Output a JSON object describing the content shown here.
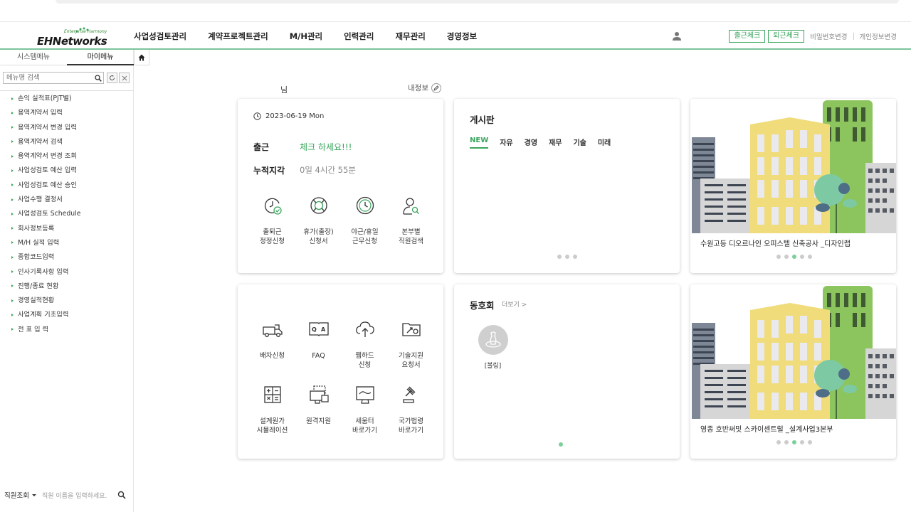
{
  "logo": {
    "sub": "Enterprise Harmony",
    "main": "EHNetworks"
  },
  "gnb": {
    "menu": [
      "사업성검토관리",
      "계약프로젝트관리",
      "M/H관리",
      "인력관리",
      "재무관리",
      "경영정보"
    ],
    "check_in": "출근체크",
    "check_out": "퇴근체크",
    "pw_change": "비밀번호변경",
    "info_change": "개인정보변경"
  },
  "sidebar": {
    "tab_system": "시스템메뉴",
    "tab_my": "마이메뉴",
    "search_placeholder": "메뉴명 검색",
    "items": [
      "손익 실적표(PJT별)",
      "용역계약서 입력",
      "용역계약서 변경 입력",
      "용역계약서 검색",
      "용역계약서 변경 조회",
      "사업성검토 예산 입력",
      "사업성검토 예산 승인",
      "사업수행 결정서",
      "사업성검토 Schedule",
      "회사정보등록",
      "M/H 실적 입력",
      "종합코드입력",
      "인사기록사항 입력",
      "진행/종료 현황",
      "경영실적현황",
      "사업계획 기초입력",
      "전 표 입 력"
    ],
    "emp_select": "직원조회",
    "emp_placeholder": "직원 이름을 입력하세요."
  },
  "greeting": {
    "name_suffix": "님",
    "my_info": "내정보"
  },
  "attendance": {
    "date": "2023-06-19 Mon",
    "in_label": "출근",
    "in_msg": "체크  하세요!!!",
    "late_label": "누적지각",
    "late_value": "0일 4시간 55분",
    "quick": [
      {
        "label": "출퇴근\n정정신청",
        "icon": "clock-check-icon"
      },
      {
        "label": "휴가(출장)\n신청서",
        "icon": "lifebuoy-icon"
      },
      {
        "label": "야근/휴일\n근무신청",
        "icon": "clock-icon"
      },
      {
        "label": "본부별\n직원검색",
        "icon": "person-search-icon"
      }
    ]
  },
  "board": {
    "title": "게시판",
    "tabs": [
      "NEW",
      "자유",
      "경영",
      "재무",
      "기술",
      "미래"
    ],
    "active_tab": "NEW"
  },
  "news1": {
    "caption": "수원고등 디오르나인 오피스텔 신축공사 _디자인랩"
  },
  "services": [
    {
      "label": "배차신청",
      "icon": "truck-icon"
    },
    {
      "label": "FAQ",
      "icon": "faq-book-icon"
    },
    {
      "label": "웹하드\n신청",
      "icon": "cloud-upload-icon"
    },
    {
      "label": "기술지원\n요청서",
      "icon": "support-folder-icon"
    },
    {
      "label": "설계원가\n시뮬레이션",
      "icon": "calculator-icon"
    },
    {
      "label": "원격지원",
      "icon": "remote-monitor-icon"
    },
    {
      "label": "세움터\n바로가기",
      "icon": "seumter-monitor-icon"
    },
    {
      "label": "국가법령\n바로가기",
      "icon": "gavel-icon"
    }
  ],
  "club": {
    "title": "동호회",
    "more": "더보기 >",
    "items": [
      {
        "label": "[볼링]"
      }
    ]
  },
  "news2": {
    "caption": "영종 호반써밋 스카이센트럴 _설계사업3본부"
  },
  "colors": {
    "accent": "#3aa55d",
    "dot_active": "#7ccf9a",
    "building_yellow": "#f0dc7a",
    "building_green": "#8cc55e"
  }
}
